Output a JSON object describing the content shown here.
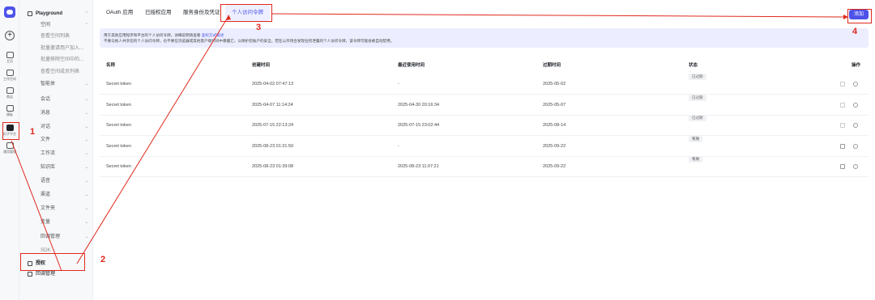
{
  "rail": {
    "items": [
      {
        "label": "主页",
        "icon": "home-icon"
      },
      {
        "label": "工作空间",
        "icon": "folder-icon"
      },
      {
        "label": "商店",
        "icon": "store-icon"
      },
      {
        "label": "模板",
        "icon": "template-icon"
      },
      {
        "label": "扣子平台",
        "icon": "platform-icon"
      },
      {
        "label": "通用管理",
        "icon": "manage-icon"
      }
    ]
  },
  "sidebar": {
    "items": [
      {
        "label": "Playground",
        "chev": "^",
        "type": "bold"
      },
      {
        "label": "空间",
        "chev": "^",
        "type": "sub"
      },
      {
        "label": "查看空间列表",
        "type": "sub2"
      },
      {
        "label": "批量邀请用户加入...",
        "type": "sub2"
      },
      {
        "label": "批量移除空间中的...",
        "type": "sub2"
      },
      {
        "label": "查看空间成员列表",
        "type": "sub2"
      },
      {
        "label": "智能体",
        "chev": "v",
        "type": "sub"
      },
      {
        "label": "会话",
        "chev": "v",
        "type": "sub"
      },
      {
        "label": "消息",
        "chev": "v",
        "type": "sub"
      },
      {
        "label": "对话",
        "chev": "v",
        "type": "sub"
      },
      {
        "label": "文件",
        "chev": "v",
        "type": "sub"
      },
      {
        "label": "工作流",
        "chev": "v",
        "type": "sub"
      },
      {
        "label": "知识库",
        "chev": "v",
        "type": "sub"
      },
      {
        "label": "语音",
        "chev": "v",
        "type": "sub"
      },
      {
        "label": "渠道",
        "chev": "v",
        "type": "sub"
      },
      {
        "label": "文件夹",
        "chev": "v",
        "type": "sub"
      },
      {
        "label": "变量",
        "chev": "v",
        "type": "sub"
      },
      {
        "label": "回调管理",
        "chev": "v",
        "type": "sub"
      },
      {
        "label": "SDK",
        "type": "sub3"
      },
      {
        "label": "授权",
        "type": "bold"
      },
      {
        "label": "回调管理",
        "type": "plain"
      }
    ]
  },
  "tabs": [
    "OAuth 应用",
    "已授权应用",
    "服务身份及凭证",
    "个人访问令牌"
  ],
  "add_button": "添加",
  "notice": {
    "line1": "用于其他应用程序和平台的个人访问令牌。详细说明请查看",
    "link": "鉴权方式概述",
    "line2": "不要与他人共享您的个人访问令牌，也不要在浏览器或其他客户端代码中暴露它，以保护您账户的安全。若在公开场合发现任何泄露的个人访问令牌，该令牌可能会被自动禁用。"
  },
  "table": {
    "headers": [
      "名称",
      "创建时间",
      "最近使用时间",
      "过期时间",
      "状态",
      "操作"
    ],
    "rows": [
      {
        "name": "Secret token",
        "created": "2025-04-02 07:47:13",
        "last_used": "-",
        "expires": "2025-05-02",
        "status": "已过期",
        "valid": false
      },
      {
        "name": "Secret token",
        "created": "2025-04-07 11:14:24",
        "last_used": "2025-04-30 20:16:34",
        "expires": "2025-05-07",
        "status": "已过期",
        "valid": false
      },
      {
        "name": "Secret token",
        "created": "2025-07-15 22:13:24",
        "last_used": "2025-07-15 23:02:44",
        "expires": "2025-08-14",
        "status": "已过期",
        "valid": false
      },
      {
        "name": "Secret token",
        "created": "2025-08-23 01:31:50",
        "last_used": "-",
        "expires": "2025-09-22",
        "status": "有效",
        "valid": true
      },
      {
        "name": "Secret token",
        "created": "2025-08-23 01:39:08",
        "last_used": "2025-08-23 11:07:21",
        "expires": "2025-09-22",
        "status": "有效",
        "valid": true
      }
    ]
  },
  "annotations": [
    "1",
    "2",
    "3",
    "4"
  ],
  "colors": {
    "accent": "#4d53e8",
    "annotation": "#e0291d",
    "notice_bg": "#eceeff"
  }
}
